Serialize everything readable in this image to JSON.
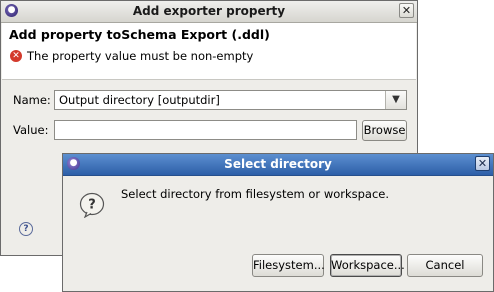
{
  "main_dialog": {
    "title": "Add exporter property",
    "close_label": "✕",
    "header_title": "Add property toSchema Export (.ddl)",
    "error_message": "The property value must be non-empty",
    "name_label": "Name:",
    "name_value": "Output directory [outputdir]",
    "value_label": "Value:",
    "value_text": "",
    "browse_label": "Browse",
    "help_icon_label": "?"
  },
  "select_dialog": {
    "title": "Select directory",
    "close_label": "✕",
    "message": "Select directory from filesystem or workspace.",
    "buttons": {
      "filesystem": "Filesystem...",
      "workspace": "Workspace...",
      "cancel": "Cancel"
    }
  },
  "icons": {
    "app": "eclipse-icon",
    "error": "error-icon",
    "help": "help-icon",
    "question": "question-icon",
    "combo": "chevron-down-icon"
  },
  "colors": {
    "dialog_bg": "#eeede9",
    "active_titlebar": "#2d5fa8",
    "error_red": "#d33a2c"
  }
}
